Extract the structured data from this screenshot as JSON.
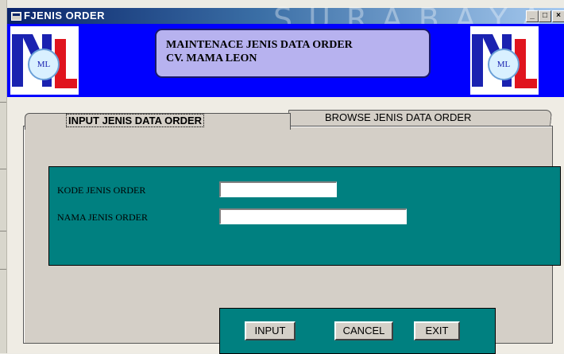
{
  "window": {
    "title": "FJENIS ORDER",
    "watermark": "SURABAYA",
    "controls": {
      "minimize": "_",
      "maximize": "□",
      "close": "×"
    }
  },
  "header": {
    "logo_text": "ML",
    "title_line1": "MAINTENACE JENIS DATA ORDER",
    "title_line2": "CV. MAMA LEON"
  },
  "tabs": [
    {
      "label": "INPUT JENIS DATA ORDER",
      "active": true
    },
    {
      "label": "BROWSE JENIS DATA ORDER",
      "active": false
    }
  ],
  "form": {
    "kode_label": "KODE JENIS ORDER",
    "kode_value": "",
    "nama_label": "NAMA JENIS ORDER",
    "nama_value": ""
  },
  "buttons": {
    "input": "INPUT",
    "cancel": "CANCEL",
    "exit": "EXIT"
  },
  "colors": {
    "header_bg": "#0000ff",
    "panel_teal": "#008080",
    "title_box": "#b7b2ef",
    "face": "#d4cfc7"
  }
}
